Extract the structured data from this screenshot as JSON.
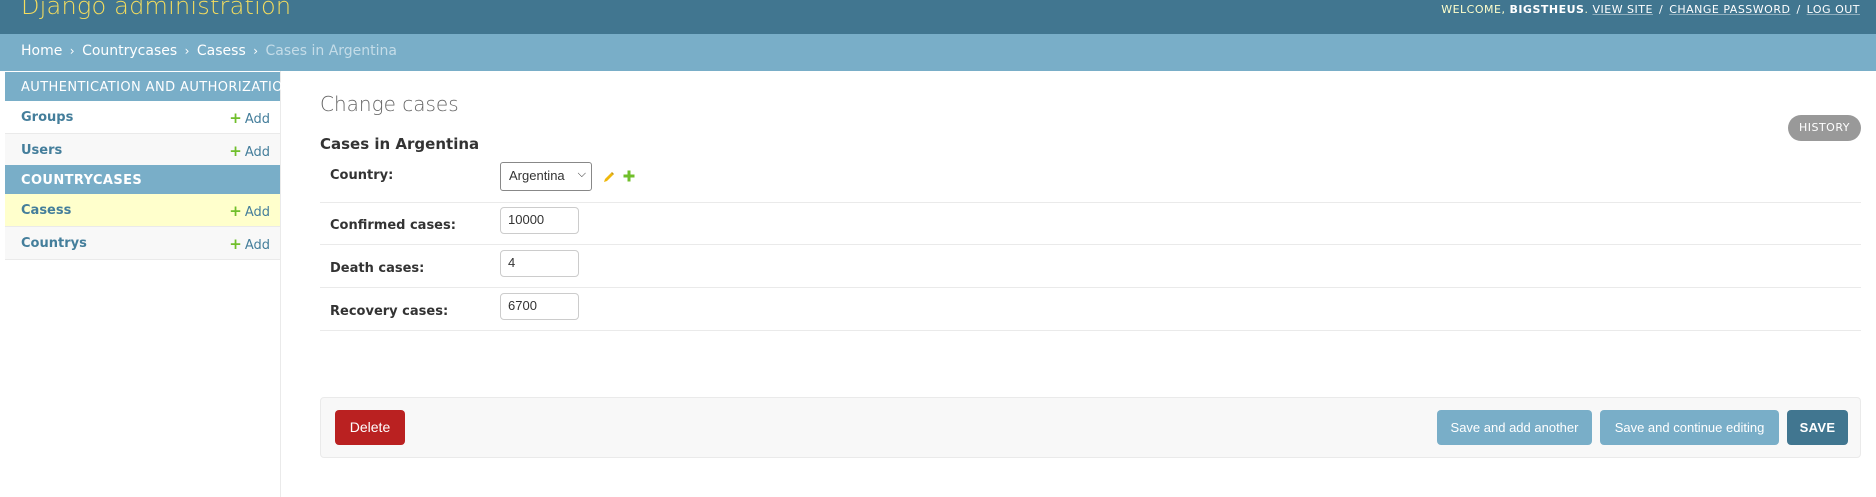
{
  "header": {
    "site_title": "Django administration",
    "welcome": "WELCOME,",
    "username": "BIGSTHEUS",
    "view_site": "VIEW SITE",
    "change_password": "CHANGE PASSWORD",
    "log_out": "LOG OUT",
    "separator": "/"
  },
  "breadcrumbs": {
    "items": [
      "Home",
      "Countrycases",
      "Casess"
    ],
    "current": "Cases in Argentina",
    "separator": "›"
  },
  "sidebar": {
    "modules": [
      {
        "caption": "Authentication and Authorization",
        "models": [
          {
            "name": "Groups",
            "add_label": "Add"
          },
          {
            "name": "Users",
            "add_label": "Add"
          }
        ]
      },
      {
        "caption": "Countrycases",
        "models": [
          {
            "name": "Casess",
            "add_label": "Add",
            "current": true
          },
          {
            "name": "Countrys",
            "add_label": "Add"
          }
        ]
      }
    ]
  },
  "content": {
    "title": "Change cases",
    "history_label": "HISTORY",
    "object_title": "Cases in Argentina",
    "fields": {
      "country": {
        "label": "Country:",
        "value": "Argentina"
      },
      "confirmed": {
        "label": "Confirmed cases:",
        "value": "10000"
      },
      "death": {
        "label": "Death cases:",
        "value": "4"
      },
      "recovery": {
        "label": "Recovery cases:",
        "value": "6700"
      }
    }
  },
  "actions": {
    "delete": "Delete",
    "save_add_another": "Save and add another",
    "save_continue": "Save and continue editing",
    "save": "SAVE"
  },
  "colors": {
    "header_bg": "#417690",
    "breadcrumb_bg": "#79aec8",
    "brand_text": "#f5dd5d",
    "link": "#447e9b",
    "add_plus": "#70bf2b",
    "delete": "#ba2121",
    "current_row": "#ffffcc"
  }
}
